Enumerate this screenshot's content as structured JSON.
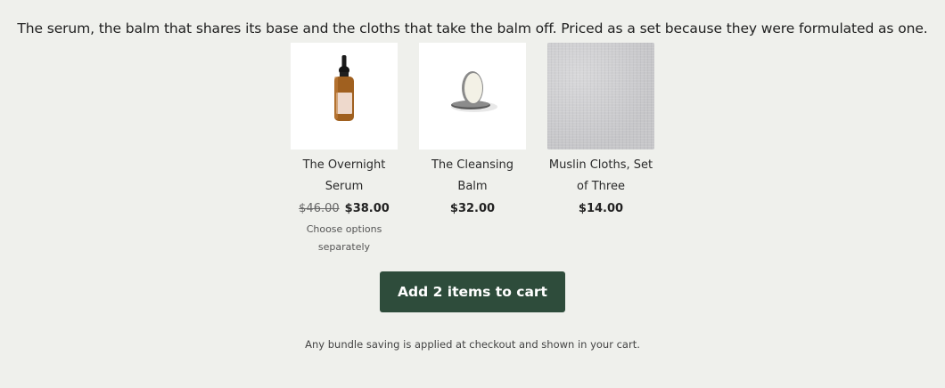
{
  "bundle": {
    "intro": "The serum, the balm that shares its base and the cloths that take the balm off. Priced as a set because they were formulated as one.",
    "products": [
      {
        "name": "The Overnight Serum",
        "old_price": "$46.00",
        "price": "$38.00",
        "note": "Choose options separately",
        "image_icon": "dropper-bottle-icon"
      },
      {
        "name": "The Cleansing Balm",
        "price": "$32.00",
        "image_icon": "balm-tin-icon"
      },
      {
        "name": "Muslin Cloths, Set of Three",
        "price": "$14.00",
        "image_icon": "muslin-cloth-image"
      }
    ],
    "add_to_cart_label": "Add 2 items to cart",
    "footnote": "Any bundle saving is applied at checkout and shown in your cart."
  },
  "colors": {
    "background": "#eff0ec",
    "button": "#2e4c3b",
    "button_text": "#ffffff"
  }
}
